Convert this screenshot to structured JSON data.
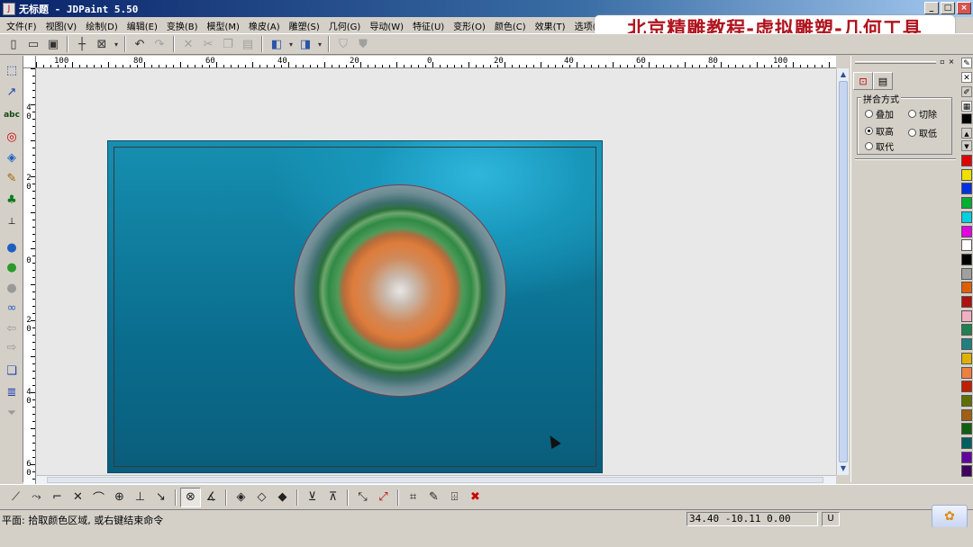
{
  "window": {
    "title": "无标题 - JDPaint 5.50",
    "minimize": "_",
    "maximize": "□",
    "close": "×"
  },
  "watermark": "北京精雕教程-虚拟雕塑-几何工具",
  "menu": [
    "文件(F)",
    "视图(V)",
    "绘制(D)",
    "编辑(E)",
    "变换(B)",
    "模型(M)",
    "橡皮(A)",
    "雕塑(S)",
    "几何(G)",
    "导动(W)",
    "特征(U)",
    "变形(O)",
    "颜色(C)",
    "效果(T)",
    "选项(P)",
    "艺"
  ],
  "ruler": {
    "h_labels": [
      "100",
      "80",
      "60",
      "40",
      "20",
      "0",
      "20",
      "40",
      "60",
      "80",
      "100"
    ],
    "v_labels": [
      [
        "4",
        "0"
      ],
      [
        "2",
        "0"
      ],
      [
        "0"
      ],
      [
        "2",
        "0"
      ],
      [
        "4",
        "0"
      ],
      [
        "6",
        "0"
      ]
    ]
  },
  "panel": {
    "group_title": "拼合方式",
    "options": [
      {
        "label": "叠加",
        "checked": false
      },
      {
        "label": "切除",
        "checked": false
      },
      {
        "label": "取高",
        "checked": true
      },
      {
        "label": "取低",
        "checked": false
      },
      {
        "label": "取代",
        "checked": false
      }
    ]
  },
  "palette": [
    "#e00000",
    "#f0e000",
    "#0030e0",
    "#00b030",
    "#00d0e0",
    "#e000e0",
    "#ffffff",
    "#000000",
    "#a0a0a0",
    "#e06000",
    "#b01010",
    "#f0b0c0",
    "#208050",
    "#208080",
    "#e0b000",
    "#f08040",
    "#c02000",
    "#607000",
    "#a06010",
    "#106010",
    "#006060",
    "#6000a0",
    "#400060"
  ],
  "status": {
    "message": "平面: 拾取颜色区域, 或右键结束命令",
    "coords": "34.40 -10.11 0.00",
    "unit": "U"
  }
}
